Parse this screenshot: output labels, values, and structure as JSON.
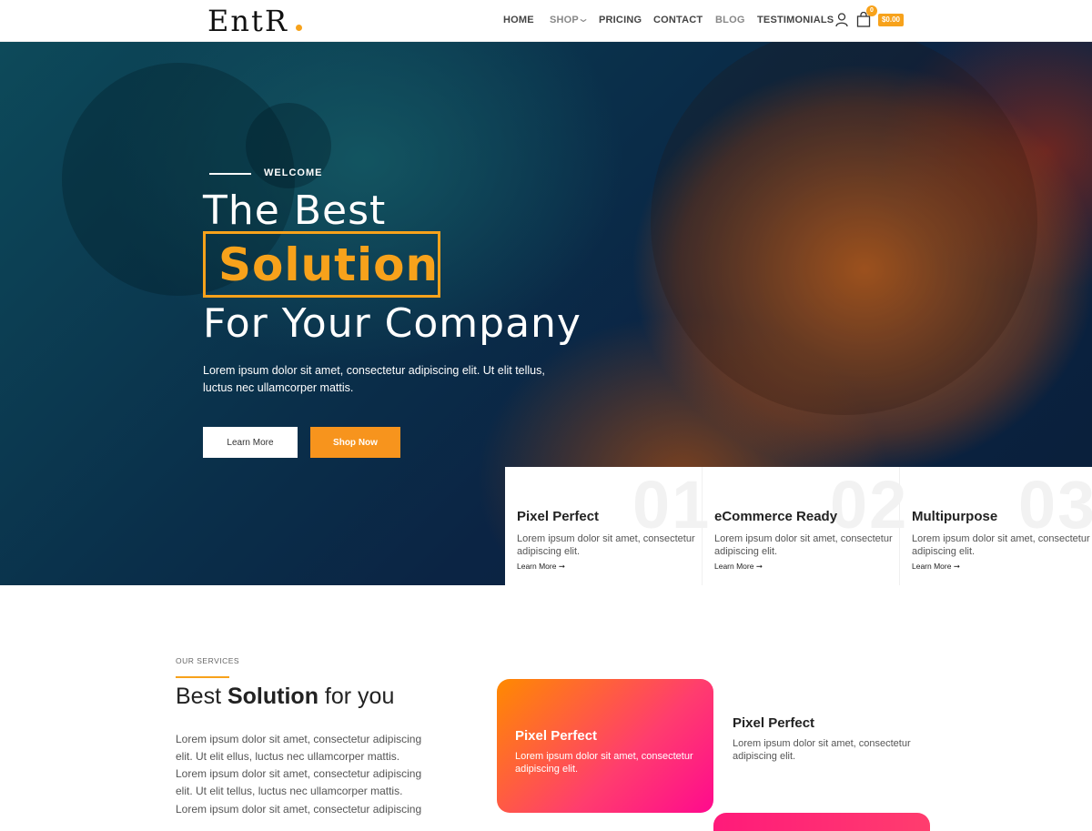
{
  "colors": {
    "accent": "#f7a21b",
    "accent_alt": "#ff8a00",
    "pink": "#ff0a8e"
  },
  "header": {
    "logo": "EntR",
    "nav": [
      "HOME",
      "SHOP",
      "PRICING",
      "CONTACT",
      "BLOG",
      "TESTIMONIALS"
    ],
    "cart_count": "0",
    "cart_total": "$0.00"
  },
  "hero": {
    "welcome": "WELCOME",
    "line1": "The Best",
    "highlight": "Solution",
    "line3": "For Your Company",
    "description": "Lorem ipsum dolor sit amet, consectetur adipiscing elit. Ut elit tellus, luctus nec ullamcorper mattis.",
    "learn_more": "Learn More",
    "shop_now": "Shop Now"
  },
  "features": [
    {
      "num": "01",
      "title": "Pixel Perfect",
      "desc": "Lorem ipsum dolor sit amet, consectetur adipiscing elit.",
      "link": "Learn More ➞"
    },
    {
      "num": "02",
      "title": "eCommerce Ready",
      "desc": "Lorem ipsum dolor sit amet, consectetur adipiscing elit.",
      "link": "Learn More ➞"
    },
    {
      "num": "03",
      "title": "Multipurpose",
      "desc": "Lorem ipsum dolor sit amet, consectetur adipiscing elit.",
      "link": "Learn More ➞"
    }
  ],
  "services": {
    "label": "OUR SERVICES",
    "title_pre": "Best ",
    "title_bold": "Solution",
    "title_post": " for you",
    "paragraphs": [
      "Lorem ipsum dolor sit amet, consectetur adipiscing elit. Ut elit  ellus, luctus nec ullamcorper mattis.",
      "Lorem ipsum dolor sit amet, consectetur adipiscing elit. Ut elit tellus, luctus nec ullamcorper mattis.",
      "Lorem ipsum dolor sit amet, consectetur adipiscing"
    ],
    "card1_title": "Pixel Perfect",
    "card1_desc": "Lorem ipsum dolor sit amet, consectetur adipiscing elit.",
    "card2_title": "Pixel Perfect",
    "card2_desc": "Lorem ipsum dolor sit amet, consectetur adipiscing elit."
  }
}
